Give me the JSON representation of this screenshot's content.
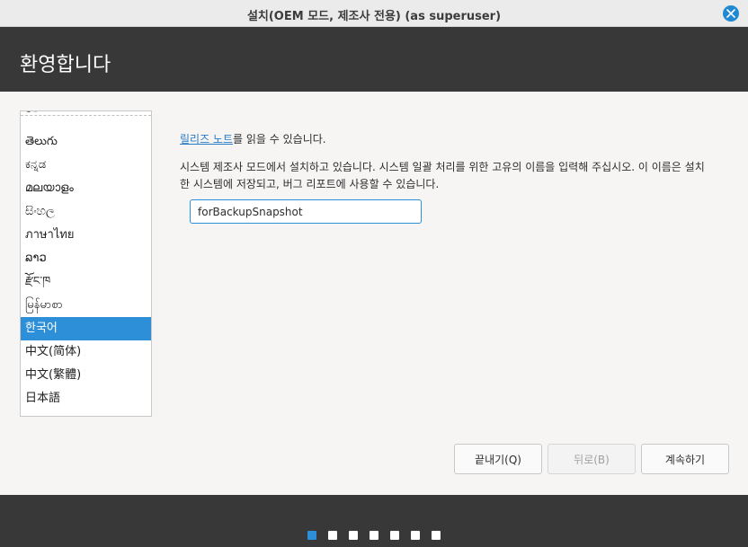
{
  "window": {
    "title": "설치(OEM 모드, 제조사 전용) (as superuser)",
    "close_icon": "close-icon",
    "accent_color": "#1f8ad2"
  },
  "header": {
    "title": "환영합니다"
  },
  "language_list": {
    "partial_top_item": "ေ",
    "items": [
      "తెలుగు",
      "ಕನ್ನಡ",
      "മലയാളം",
      "සිංහල",
      "ภาษาไทย",
      "ລາວ",
      "རྫོང་ཁ",
      "မြန်မာစာ",
      "한국어",
      "中文(简体)",
      "中文(繁體)",
      "日本語"
    ],
    "selected": "한국어",
    "selected_color": "#2c8fd8"
  },
  "content": {
    "release_notes_link": "릴리즈 노트",
    "release_notes_suffix": "를 읽을 수 있습니다.",
    "description": "시스템 제조사 모드에서 설치하고 있습니다. 시스템 일괄 처리를 위한 고유의 이름을 입력해 주십시오. 이 이름은 설치한 시스템에 저장되고, 버그 리포트에 사용할 수 있습니다.",
    "batch_name_value": "forBackupSnapshot"
  },
  "buttons": {
    "quit": "끝내기(Q)",
    "back": "뒤로(B)",
    "continue": "계속하기"
  },
  "progress": {
    "total_steps": 7,
    "current_step": 1
  }
}
